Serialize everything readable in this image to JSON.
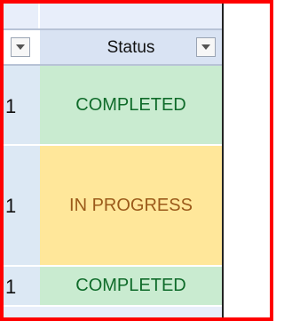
{
  "header": {
    "status_label": "Status"
  },
  "rows": [
    {
      "number": "1",
      "status": "COMPLETED"
    },
    {
      "number": "1",
      "status": "IN PROGRESS"
    },
    {
      "number": "1",
      "status": "COMPLETED"
    }
  ],
  "colors": {
    "frame_border": "#ff0000",
    "completed_bg": "#c9ebd0",
    "completed_text": "#0f6b2a",
    "in_progress_bg": "#ffe79a",
    "in_progress_text": "#9b5a1a",
    "header_bg": "#d9e3f3"
  }
}
